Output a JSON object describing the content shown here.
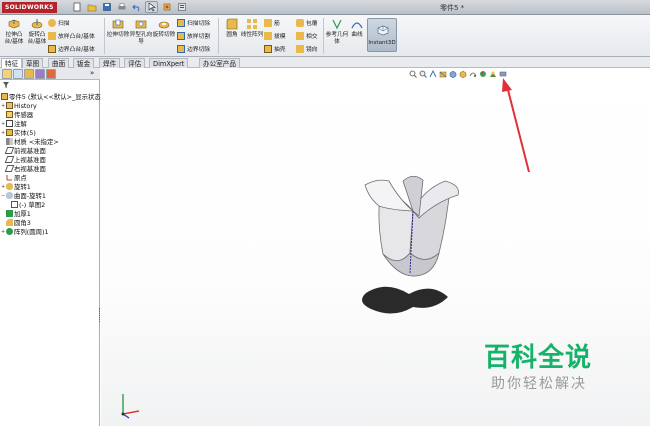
{
  "app": {
    "brand": "SOLIDWORKS",
    "document_title": "零件5 *"
  },
  "ribbon": {
    "extrude_boss": "拉伸凸台/基体",
    "revolve_boss": "旋转凸台/基体",
    "sweep": "扫描",
    "loft_boss": "放样凸台/基体",
    "boundary_boss": "边界凸台/基体",
    "extrude_cut": "拉伸切除",
    "hole_wizard": "异型孔向导",
    "revolve_cut": "旋转切除",
    "swept_cut": "扫描切除",
    "lofted_cut": "放样切割",
    "boundary_cut": "边界切除",
    "fillet": "圆角",
    "linear_pattern": "线性阵列",
    "rib": "筋",
    "draft": "拔模",
    "shell": "抽壳",
    "wrap": "包覆",
    "intersect": "相交",
    "mirror": "镜向",
    "reference_geometry": "参考几何体",
    "curves": "曲线",
    "instant3d": "Instant3D"
  },
  "tabs": [
    "特征",
    "草图",
    "曲面",
    "钣金",
    "焊件",
    "评估",
    "DimXpert",
    "办公室产品"
  ],
  "tree": {
    "root": "零件5 (默认<<默认>_显示状态",
    "items": [
      "History",
      "传感器",
      "注解",
      "实体(5)",
      "材质 <未指定>",
      "前视基准面",
      "上视基准面",
      "右视基准面",
      "原点",
      "旋转1",
      "曲面-旋转1",
      "(-) 草图2",
      "加厚1",
      "圆角3",
      "阵列(圆周)1"
    ]
  },
  "watermark": {
    "main": "百科全说",
    "sub": "助你轻松解决"
  },
  "colors": {
    "accent": "#b4222a",
    "arrow": "#e0303a",
    "watermark": "#15b36a"
  },
  "icons": [
    "new-icon",
    "open-icon",
    "save-icon",
    "print-icon",
    "undo-icon",
    "select-icon",
    "rebuild-icon",
    "options-icon"
  ]
}
